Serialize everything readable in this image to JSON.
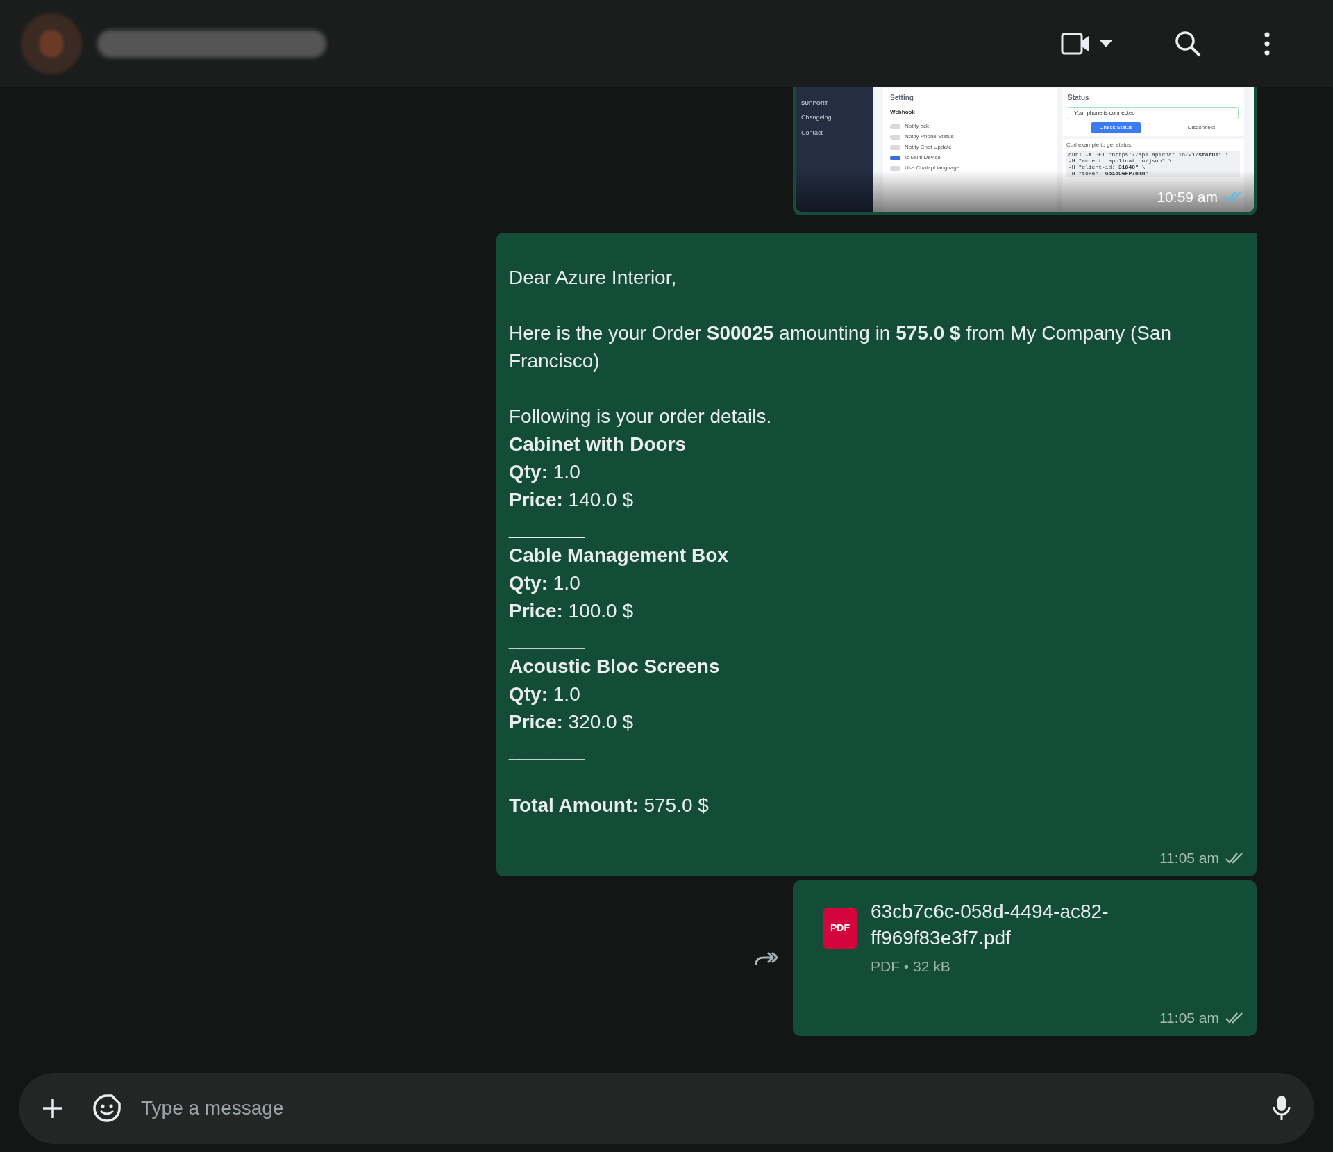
{
  "messages": [
    {
      "kind": "image",
      "time": "10:59 am",
      "read": true,
      "screenshot": {
        "sidebar": {
          "section": "SUPPORT",
          "items": [
            "Changelog",
            "Contact"
          ]
        },
        "setting": {
          "title": "Setting",
          "field_label": "Webhook",
          "toggles": [
            {
              "label": "Notify ack",
              "on": false
            },
            {
              "label": "Notify Phone Status",
              "on": false
            },
            {
              "label": "Notify Chat Update",
              "on": false
            },
            {
              "label": "Is Multi Device",
              "on": true
            },
            {
              "label": "Use Chatapi language",
              "on": false
            }
          ]
        },
        "status": {
          "title": "Status",
          "banner": "Your phone is connected",
          "primary_button": "Check Status",
          "secondary_button": "Disconnect",
          "code_caption": "Curl example to get status:",
          "code_lines": [
            "curl -X GET \"https://api.apichat.io/v1/**status**\" \\",
            "-H \"accept: application/json\" \\",
            "-H \"client-id: **31840**\" \\",
            "-H \"token: **GbiduGFP7nlm**\""
          ]
        }
      }
    },
    {
      "kind": "text",
      "time": "11:05 am",
      "read": false,
      "paragraphs": [
        [
          "Dear Azure Interior,"
        ],
        [
          "Here is the your Order **S00025** amounting in **575.0 $** from My Company (San Francisco)"
        ],
        [
          "Following is your order details.",
          "**Cabinet with Doors**",
          "**Qty:** 1.0",
          "**Price:** 140.0 $",
          "_______",
          "**Cable Management Box**",
          "**Qty:** 1.0",
          "**Price:** 100.0 $",
          "_______",
          "**Acoustic Bloc Screens**",
          "**Qty:** 1.0",
          "**Price:** 320.0 $",
          "_______"
        ],
        [
          "**Total Amount:** 575.0 $"
        ]
      ]
    },
    {
      "kind": "document",
      "time": "11:05 am",
      "read": false,
      "icon_label": "PDF",
      "file_name": "63cb7c6c-058d-4494-ac82-ff969f83e3f7.pdf",
      "meta": "PDF • 32 kB"
    }
  ],
  "composer": {
    "placeholder": "Type a message"
  }
}
